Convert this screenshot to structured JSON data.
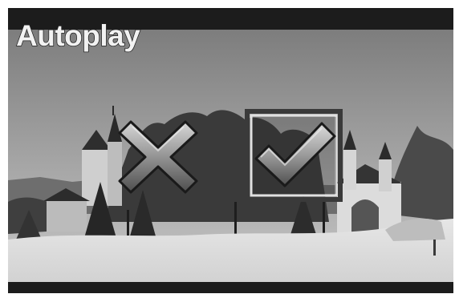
{
  "screen": {
    "title": "Autoplay"
  },
  "controls": {
    "reject_icon": "x-mark-icon",
    "accept_icon": "checkmark-icon"
  },
  "colors": {
    "letterbox": "#1c1c1c",
    "title_text": "#f2f2f2"
  }
}
